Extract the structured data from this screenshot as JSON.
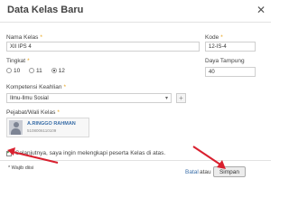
{
  "dialog": {
    "title": "Data Kelas Baru",
    "close_icon": "close-icon"
  },
  "form": {
    "nama_kelas": {
      "label": "Nama Kelas",
      "value": "XII IPS 4"
    },
    "kode": {
      "label": "Kode",
      "value": "12-IS-4"
    },
    "tingkat": {
      "label": "Tingkat",
      "options": [
        "10",
        "11",
        "12"
      ],
      "selected": "12"
    },
    "daya_tampung": {
      "label": "Daya Tampung",
      "value": "40"
    },
    "kompetensi": {
      "label": "Kompetensi Keahlian",
      "value": "Ilmu-Ilmu Sosial",
      "add_label": "+"
    },
    "pejabat": {
      "label": "Pejabat/Wali Kelas",
      "name": "A.RINGGO RAHMAN",
      "nip": "5108006110109"
    },
    "checkbox_label": "Selanjutnya, saya ingin melengkapi peserta Kelas di atas.",
    "required_mark": "*"
  },
  "footer": {
    "wajib": "* Wajib diisi",
    "batal": "Batal",
    "atau": "atau",
    "simpan": "Simpan"
  },
  "colors": {
    "accent_arrow": "#d9202f",
    "required": "#e8a317"
  }
}
